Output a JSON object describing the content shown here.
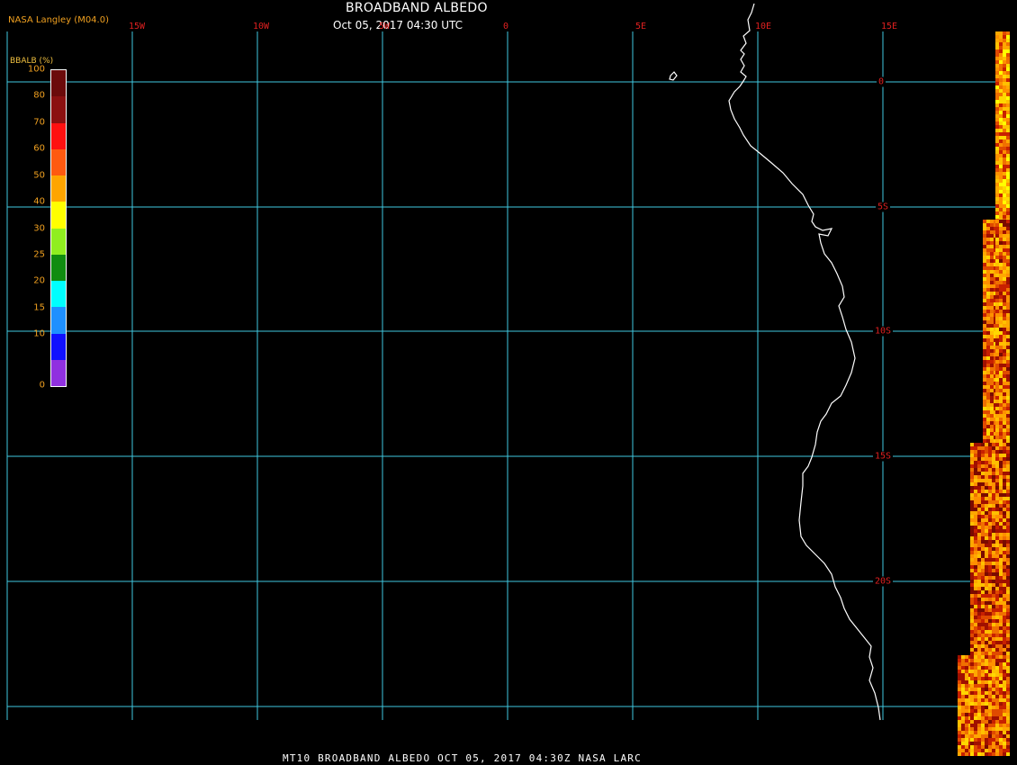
{
  "header": {
    "title": "BROADBAND ALBEDO",
    "subtitle": "Oct 05, 2017 04:30 UTC",
    "credit": "NASA Langley (M04.0)"
  },
  "footer": {
    "text": "MT10  BROADBAND ALBEDO   OCT 05, 2017 04:30Z   NASA LARC"
  },
  "map": {
    "longitude_labels": [
      "15W",
      "10W",
      "5W",
      "0",
      "5E",
      "10E",
      "15E"
    ],
    "latitude_labels": [
      "0",
      "5S",
      "10S",
      "15S",
      "20S"
    ],
    "grid_color": "#40c8e0",
    "label_color": "#e02020",
    "coastline_color": "#ffffff"
  },
  "colorbar": {
    "title": "BBALB (%)",
    "ticks": [
      "100",
      "80",
      "70",
      "60",
      "50",
      "40",
      "30",
      "25",
      "20",
      "15",
      "10",
      "0"
    ],
    "colors": [
      "#6b0a0a",
      "#8b1010",
      "#ff1010",
      "#ff5a10",
      "#ffa500",
      "#ffff00",
      "#90ee20",
      "#108c10",
      "#00ffff",
      "#1e90ff",
      "#1010ff",
      "#9030e0"
    ]
  }
}
